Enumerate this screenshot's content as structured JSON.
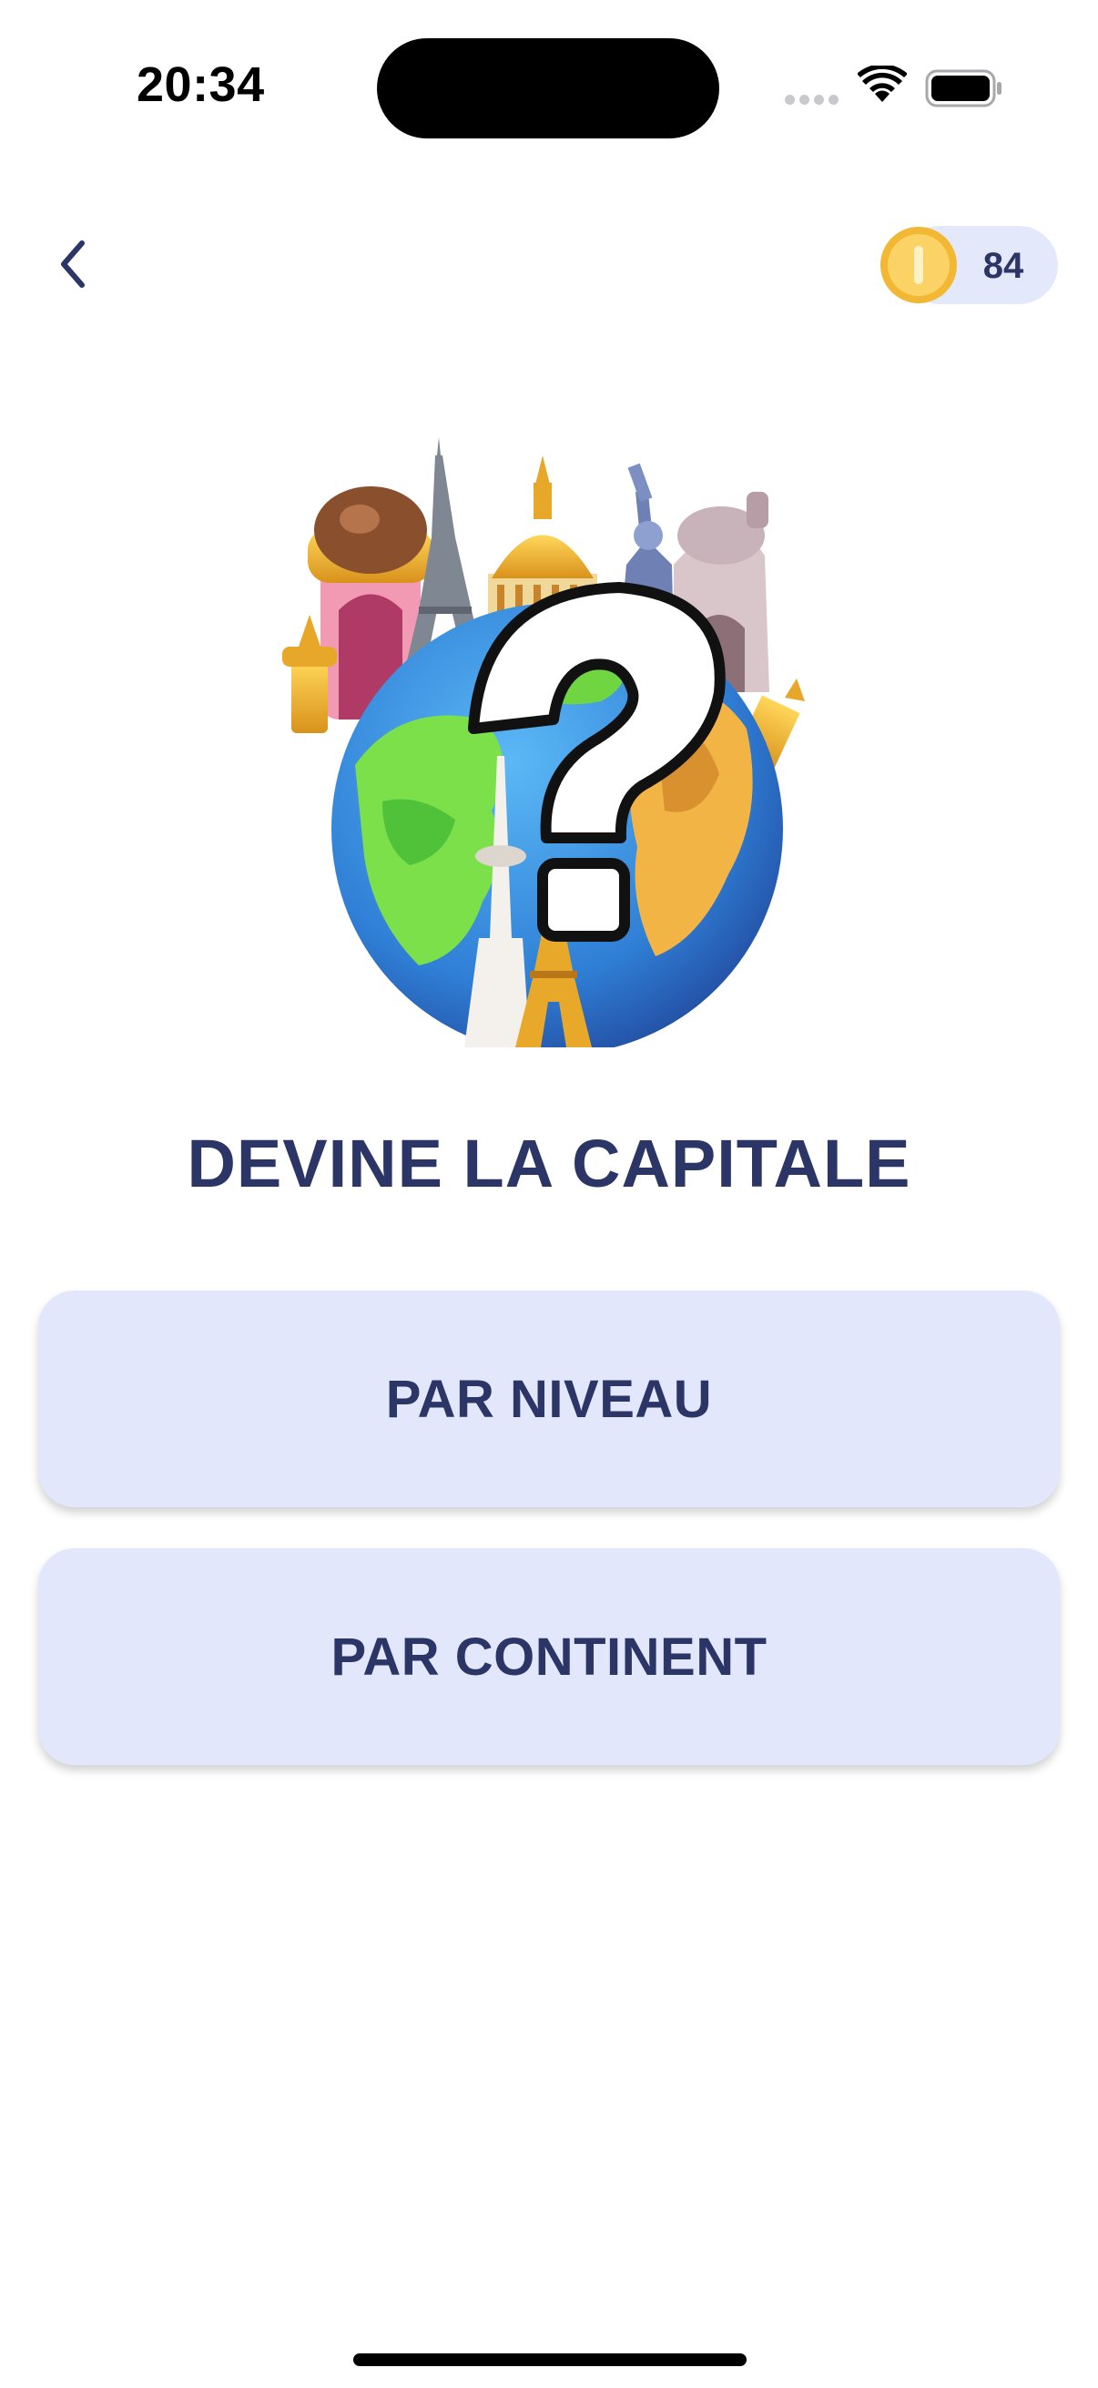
{
  "status_bar": {
    "time": "20:34"
  },
  "header": {
    "back_icon": "chevron-left-icon",
    "coins": "84",
    "coin_icon": "coin-icon"
  },
  "hero": {
    "image": "globe-landmarks-question-illustration"
  },
  "main": {
    "title": "DEVINE LA CAPITALE",
    "buttons": [
      {
        "label": "PAR NIVEAU"
      },
      {
        "label": "PAR CONTINENT"
      }
    ]
  },
  "colors": {
    "text_primary": "#2b3566",
    "button_bg": "#e2e7fb",
    "coin_gold": "#f8c945"
  }
}
